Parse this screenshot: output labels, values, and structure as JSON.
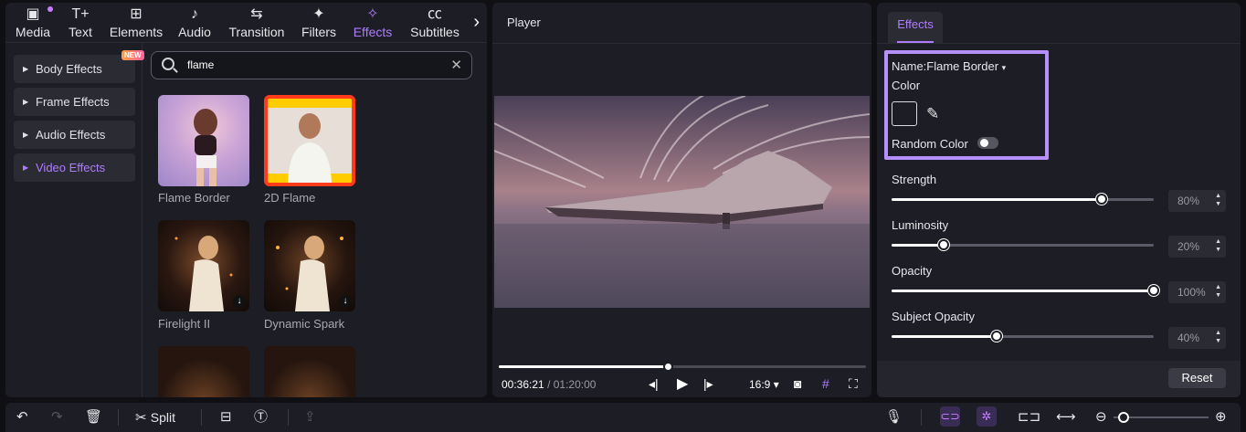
{
  "top_tabs": [
    {
      "label": "Media",
      "icon": "media-icon"
    },
    {
      "label": "Text",
      "icon": "text-icon"
    },
    {
      "label": "Elements",
      "icon": "elements-icon"
    },
    {
      "label": "Audio",
      "icon": "audio-icon"
    },
    {
      "label": "Transition",
      "icon": "transition-icon"
    },
    {
      "label": "Filters",
      "icon": "filters-icon"
    },
    {
      "label": "Effects",
      "icon": "effects-icon",
      "active": true
    },
    {
      "label": "Subtitles",
      "icon": "subtitles-icon"
    }
  ],
  "sidebar": {
    "items": [
      {
        "label": "Body Effects",
        "badge": "NEW"
      },
      {
        "label": "Frame Effects"
      },
      {
        "label": "Audio Effects"
      },
      {
        "label": "Video Effects",
        "active": true
      }
    ]
  },
  "search": {
    "value": "flame"
  },
  "effects": [
    {
      "name": "Flame Border"
    },
    {
      "name": "2D Flame"
    },
    {
      "name": "Firelight II"
    },
    {
      "name": "Dynamic Spark"
    },
    {
      "name": ""
    },
    {
      "name": ""
    }
  ],
  "player": {
    "title": "Player",
    "current_time": "00:36:21",
    "total_time": "/ 01:20:00",
    "aspect": "16:9",
    "progress": 0.46
  },
  "properties": {
    "tab": "Effects",
    "name_label": "Name:Flame Border",
    "color_label": "Color",
    "random_color_label": "Random Color",
    "random_color_on": false,
    "params": [
      {
        "label": "Strength",
        "value": "80%",
        "level": 0.8
      },
      {
        "label": "Luminosity",
        "value": "20%",
        "level": 0.2
      },
      {
        "label": "Opacity",
        "value": "100%",
        "level": 1.0
      },
      {
        "label": "Subject Opacity",
        "value": "40%",
        "level": 0.4
      }
    ],
    "reset_label": "Reset"
  },
  "toolbar": {
    "split_label": "Split",
    "zoom_level": 0.05
  },
  "colors": {
    "accent": "#b07cff",
    "highlight": "#b690ff",
    "panel": "#1d1e25"
  }
}
